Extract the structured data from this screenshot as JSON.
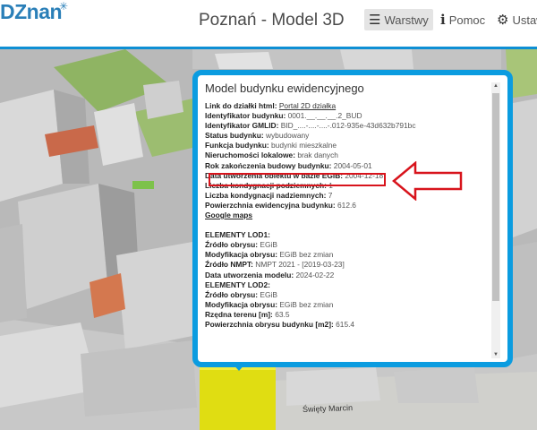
{
  "header": {
    "logo_text": "DZnan",
    "title": "Poznań - Model 3D",
    "nav": {
      "layers_label": "Warstwy",
      "help_label": "Pomoc",
      "settings_label": "Ustaw"
    }
  },
  "popup": {
    "title": "Model budynku ewidencyjnego",
    "rows": [
      {
        "label": "Link do działki html:",
        "value": "Portal 2D działka",
        "link": true
      },
      {
        "label": "Identyfikator budynku:",
        "value": "0001.__.__.__.2_BUD"
      },
      {
        "label": "Identyfikator GMLID:",
        "value": "BID_....-....-....-.012-935e-43d632b791bc"
      },
      {
        "label": "Status budynku:",
        "value": "wybudowany"
      },
      {
        "label": "Funkcja budynku:",
        "value": "budynki mieszkalne"
      },
      {
        "label": "Nieruchomości lokalowe:",
        "value": "brak danych"
      },
      {
        "label": "Rok zakończenia budowy budynku:",
        "value": "2004-05-01"
      },
      {
        "label": "Data utworzenia obiektu w bazie EGiB:",
        "value": "2004-12-18"
      },
      {
        "label": "Liczba kondygnacji podziemnych:",
        "value": "1"
      },
      {
        "label": "Liczba kondygnacji nadziemnych:",
        "value": "7"
      },
      {
        "label": "Powierzchnia ewidencyjna budynku:",
        "value": "612.6"
      }
    ],
    "google_maps": "Google maps",
    "lod1_heading": "ELEMENTY LOD1:",
    "lod1_rows": [
      {
        "label": "Źródło obrysu:",
        "value": "EGiB"
      },
      {
        "label": "Modyfikacja obrysu:",
        "value": "EGiB bez zmian"
      },
      {
        "label": "Źródło NMPT:",
        "value": "NMPT 2021 - [2019-03-23]"
      },
      {
        "label": "Data utworzenia modelu:",
        "value": "2024-02-22"
      }
    ],
    "lod2_heading": "ELEMENTY LOD2:",
    "lod2_rows": [
      {
        "label": "Źródło obrysu:",
        "value": "EGiB"
      },
      {
        "label": "Modyfikacja obrysu:",
        "value": "EGiB bez zmian"
      },
      {
        "label": "Rzędna terenu [m]:",
        "value": "63.5"
      },
      {
        "label": "Powierzchnia obrysu budynku [m2]:",
        "value": "615.4"
      }
    ]
  },
  "map": {
    "street_label": "Święty Marcin"
  },
  "colors": {
    "accent": "#0b9ce0",
    "annotation": "#d8141c",
    "selected_building": "#e0dd12"
  },
  "icons": {
    "layers": "hamburger-icon",
    "help": "info-icon",
    "settings": "gear-icon"
  }
}
